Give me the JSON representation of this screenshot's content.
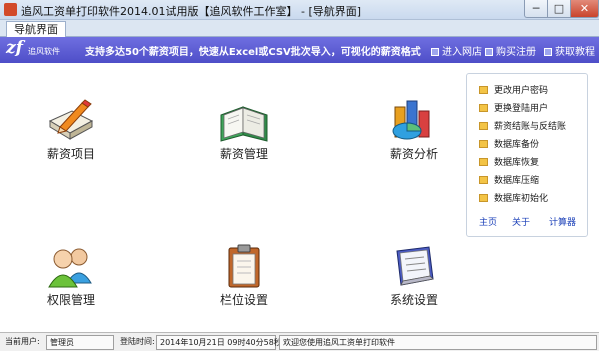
{
  "window": {
    "title": "追风工资单打印软件2014.01试用版【追风软件工作室】 - [导航界面]",
    "minimize": "─",
    "maximize": "□",
    "close": "✕"
  },
  "tab": {
    "label": "导航界面"
  },
  "banner": {
    "logo_mark": "zf",
    "logo_text": "追风软件",
    "slogan": "支持多达50个薪资项目，快速从Excel或CSV批次导入，可视化的薪资格式",
    "links": [
      "进入网店",
      "购买注册",
      "获取教程"
    ]
  },
  "modules": [
    {
      "label": "薪资项目",
      "icon": "pencil-book-icon"
    },
    {
      "label": "薪资管理",
      "icon": "open-book-icon"
    },
    {
      "label": "薪资分析",
      "icon": "chart-icon"
    },
    {
      "label": "权限管理",
      "icon": "users-icon"
    },
    {
      "label": "栏位设置",
      "icon": "clipboard-icon"
    },
    {
      "label": "系统设置",
      "icon": "settings-document-icon"
    }
  ],
  "side_panel": {
    "items": [
      "更改用户密码",
      "更换登陆用户",
      "薪资结账与反结账",
      "数据库备份",
      "数据库恢复",
      "数据库压缩",
      "数据库初始化"
    ],
    "links": [
      "主页",
      "关于",
      "计算器"
    ]
  },
  "status": {
    "user_label": "当前用户:",
    "user_value": "管理员",
    "login_label": "登陆时间:",
    "login_value": "2014年10月21日  09时40分58秒",
    "message": "欢迎您使用追风工资单打印软件"
  }
}
